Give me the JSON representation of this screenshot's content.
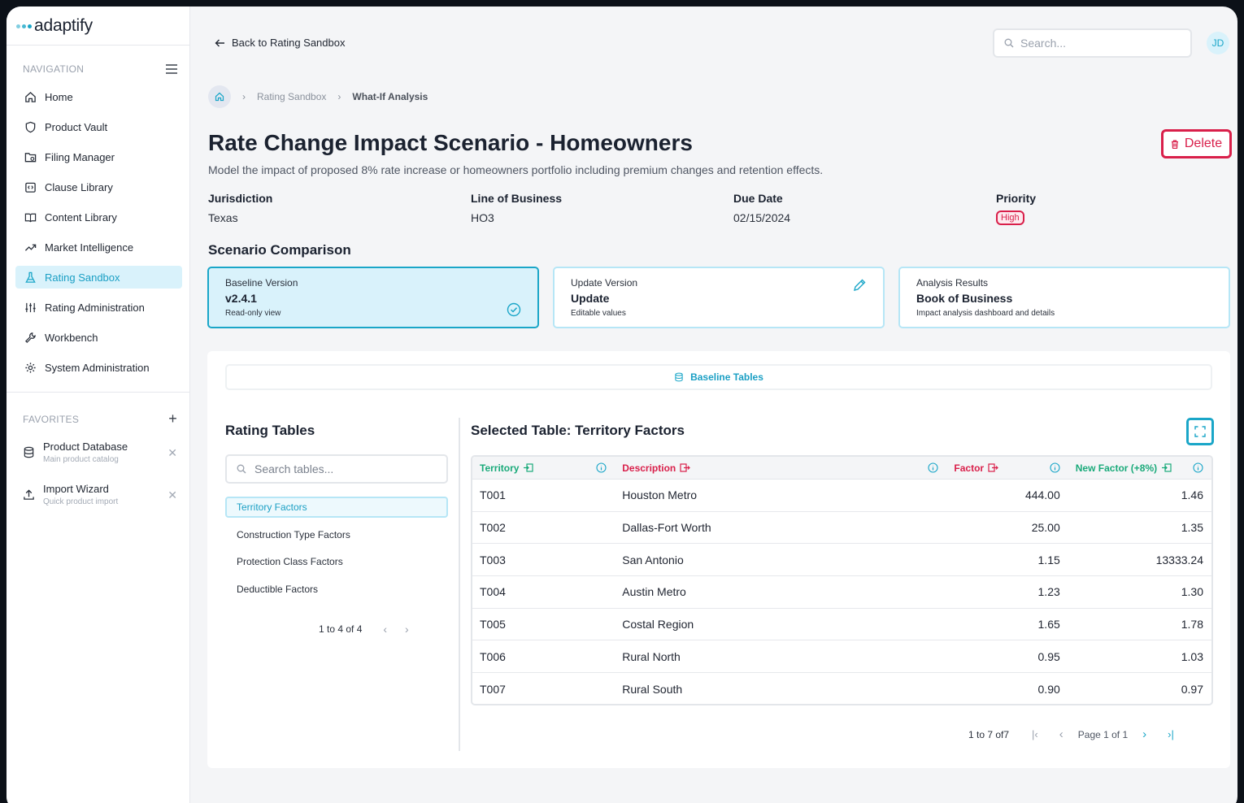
{
  "app": {
    "logo_text": "adaptify"
  },
  "sidebar": {
    "nav_heading": "NAVIGATION",
    "items": [
      {
        "label": "Home",
        "icon": "home-icon"
      },
      {
        "label": "Product Vault",
        "icon": "shield-icon"
      },
      {
        "label": "Filing Manager",
        "icon": "folder-icon"
      },
      {
        "label": "Clause Library",
        "icon": "clause-icon"
      },
      {
        "label": "Content Library",
        "icon": "book-icon"
      },
      {
        "label": "Market Intelligence",
        "icon": "trend-icon"
      },
      {
        "label": "Rating Sandbox",
        "icon": "flask-icon",
        "active": true
      },
      {
        "label": "Rating Administration",
        "icon": "sliders-icon"
      },
      {
        "label": "Workbench",
        "icon": "wrench-icon"
      },
      {
        "label": "System Administration",
        "icon": "gear-icon"
      }
    ],
    "favorites_heading": "FAVORITES",
    "favorites": [
      {
        "title": "Product Database",
        "subtitle": "Main product catalog",
        "icon": "database-icon"
      },
      {
        "title": "Import Wizard",
        "subtitle": "Quick product import",
        "icon": "upload-icon"
      }
    ]
  },
  "header": {
    "back_label": "Back to Rating Sandbox",
    "search_placeholder": "Search...",
    "avatar_initials": "JD"
  },
  "breadcrumb": {
    "items": [
      "Rating Sandbox",
      "What-If Analysis"
    ]
  },
  "scenario": {
    "title": "Rate Change Impact Scenario - Homeowners",
    "description": "Model the impact of proposed 8% rate increase or homeowners portfolio including premium changes and retention effects.",
    "delete_label": "Delete",
    "meta": [
      {
        "label": "Jurisdiction",
        "value": "Texas"
      },
      {
        "label": "Line of Business",
        "value": "HO3"
      },
      {
        "label": "Due Date",
        "value": "02/15/2024"
      },
      {
        "label": "Priority",
        "value": "High"
      }
    ]
  },
  "comparison": {
    "heading": "Scenario Comparison",
    "cards": [
      {
        "label": "Baseline Version",
        "title": "v2.4.1",
        "subtitle": "Read-only view",
        "icon": "check-circle-icon"
      },
      {
        "label": "Update Version",
        "title": "Update",
        "subtitle": "Editable values",
        "icon": "pencil-icon"
      },
      {
        "label": "Analysis Results",
        "title": "Book of Business",
        "subtitle": "Impact analysis dashboard and details"
      }
    ]
  },
  "panel": {
    "tab_label": "Baseline Tables",
    "rating_tables": {
      "title": "Rating Tables",
      "search_placeholder": "Search tables...",
      "items": [
        "Territory Factors",
        "Construction Type Factors",
        "Protection Class Factors",
        "Deductible Factors"
      ],
      "pager_text": "1 to 4 of 4"
    },
    "selected_table": {
      "title": "Selected Table: Territory Factors",
      "columns": [
        "Territory",
        "Description",
        "Factor",
        "New Factor (+8%)"
      ],
      "column_colors": [
        "#1aaa7a",
        "#d91f4a",
        "#d91f4a",
        "#1aaa7a"
      ],
      "rows": [
        [
          "T001",
          "Houston Metro",
          "444.00",
          "1.46"
        ],
        [
          "T002",
          "Dallas-Fort Worth",
          "25.00",
          "1.35"
        ],
        [
          "T003",
          "San Antonio",
          "1.15",
          "13333.24"
        ],
        [
          "T004",
          "Austin Metro",
          "1.23",
          "1.30"
        ],
        [
          "T005",
          "Costal Region",
          "1.65",
          "1.78"
        ],
        [
          "T006",
          "Rural North",
          "0.95",
          "1.03"
        ],
        [
          "T007",
          "Rural South",
          "0.90",
          "0.97"
        ]
      ],
      "pager_count": "1 to 7 of7",
      "pager_page": "Page 1 of 1"
    }
  },
  "colors": {
    "accent": "#1aa6c8",
    "danger": "#d91f4a",
    "success": "#1aaa7a"
  }
}
